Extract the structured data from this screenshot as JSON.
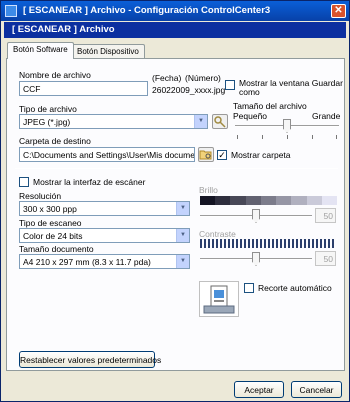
{
  "window": {
    "title": "[ ESCANEAR ]  Archivo - Configuración ControlCenter3",
    "banner": "[ ESCANEAR ]  Archivo",
    "close_glyph": "✕"
  },
  "tabs": [
    {
      "label": "Botón Software"
    },
    {
      "label": "Botón Dispositivo"
    }
  ],
  "file": {
    "name_label": "Nombre de archivo",
    "name_value": "CCF",
    "fecha_label": "(Fecha)",
    "numero_label": "(Número)",
    "filename_preview": "26022009_xxxx.jpg",
    "show_save_as_label": "Mostrar la ventana Guardar como",
    "type_label": "Tipo de archivo",
    "type_value": "JPEG (*.jpg)",
    "size_label": "Tamaño del archivo",
    "size_small": "Pequeño",
    "size_large": "Grande",
    "size_level": 0.5,
    "dest_label": "Carpeta de destino",
    "dest_value": "C:\\Documents and Settings\\User\\Mis documentos\\Mi",
    "show_folder_label": "Mostrar carpeta",
    "show_folder_checked": "✓"
  },
  "scanner": {
    "show_interface_label": "Mostrar la interfaz de escáner",
    "resolution_label": "Resolución",
    "resolution_value": "300 x 300 ppp",
    "scan_type_label": "Tipo de escaneo",
    "scan_type_value": "Color de 24 bits",
    "doc_size_label": "Tamaño documento",
    "doc_size_value": "A4 210 x 297 mm (8.3 x 11.7 pda)",
    "brightness_label": "Brillo",
    "brightness_value": "50",
    "contrast_label": "Contraste",
    "contrast_value": "50",
    "autocrop_label": "Recorte automático"
  },
  "buttons": {
    "restore_defaults": "Restablecer valores predeterminados",
    "accept": "Aceptar",
    "cancel": "Cancelar"
  },
  "icons": {
    "title": "app-icon",
    "close": "close-icon",
    "settings": "key-settings-icon",
    "folder": "folder-browse-icon",
    "scan_preview": "document-scan-icon"
  }
}
